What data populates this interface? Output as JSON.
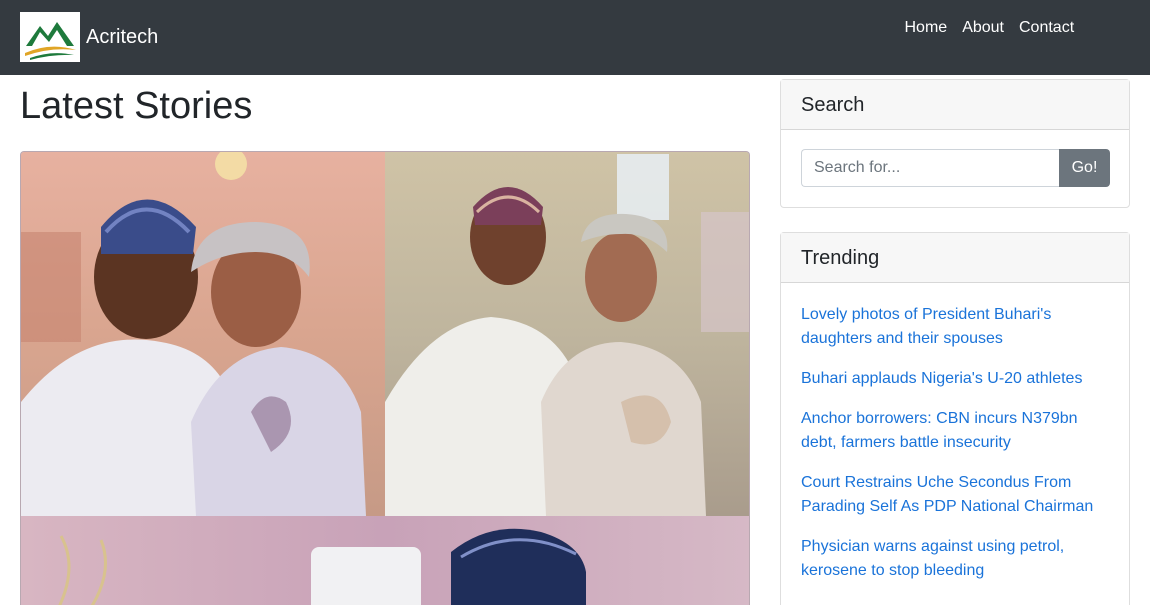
{
  "navbar": {
    "brand": "Acritech",
    "links": [
      "Home",
      "About",
      "Contact"
    ]
  },
  "main": {
    "title": "Latest Stories"
  },
  "sidebar": {
    "search": {
      "title": "Search",
      "placeholder": "Search for...",
      "button": "Go!"
    },
    "trending": {
      "title": "Trending",
      "items": [
        "Lovely photos of President Buhari's daughters and their spouses",
        "Buhari applauds Nigeria's U-20 athletes",
        "Anchor borrowers: CBN incurs N379bn debt, farmers battle insecurity",
        "Court Restrains Uche Secondus From Parading Self As PDP National Chairman",
        "Physician warns against using petrol, kerosene to stop bleeding"
      ]
    }
  },
  "colors": {
    "navbar": "#343a40",
    "link": "#1a73d9",
    "button": "#6c757d",
    "logo_green": "#1e7a3c",
    "logo_gold": "#e0a526"
  },
  "icons": {
    "logo": "mountain-logo-icon"
  }
}
